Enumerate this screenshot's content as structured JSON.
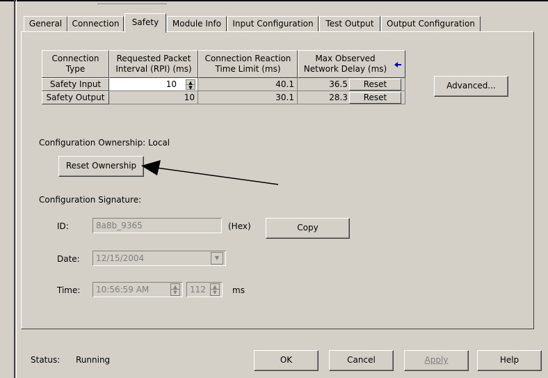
{
  "tabs": [
    "General",
    "Connection",
    "Safety",
    "Module Info",
    "Input Configuration",
    "Test Output",
    "Output Configuration"
  ],
  "active_tab": "Safety",
  "table": {
    "headers": [
      [
        "Connection",
        "Type"
      ],
      [
        "Requested Packet",
        "Interval (RPI) (ms)"
      ],
      [
        "Connection Reaction",
        "Time Limit (ms)"
      ],
      [
        "Max Observed",
        "Network Delay (ms)"
      ]
    ],
    "rows": [
      {
        "type": "Safety Input",
        "rpi": "10",
        "limit": "40.1",
        "delay": "36.5",
        "reset": "Reset"
      },
      {
        "type": "Safety Output",
        "rpi": "10",
        "limit": "30.1",
        "delay": "28.3",
        "reset": "Reset"
      }
    ]
  },
  "advanced_label": "Advanced...",
  "ownership_label": "Configuration Ownership: Local",
  "reset_ownership_label": "Reset Ownership",
  "signature_label": "Configuration Signature:",
  "id_label": "ID:",
  "id_value": "8a8b_9365",
  "hex_label": "(Hex)",
  "copy_label": "Copy",
  "date_label": "Date:",
  "date_value": "12/15/2004",
  "time_label": "Time:",
  "time_value": "10:56:59 AM",
  "ms_value": "112",
  "ms_label": "ms",
  "status_label": "Status:",
  "status_value": "Running",
  "buttons": {
    "ok": "OK",
    "cancel": "Cancel",
    "apply": "Apply",
    "help": "Help"
  },
  "icons": {
    "blue_arrow": "left-arrow-icon",
    "accent": "#0000c0"
  }
}
